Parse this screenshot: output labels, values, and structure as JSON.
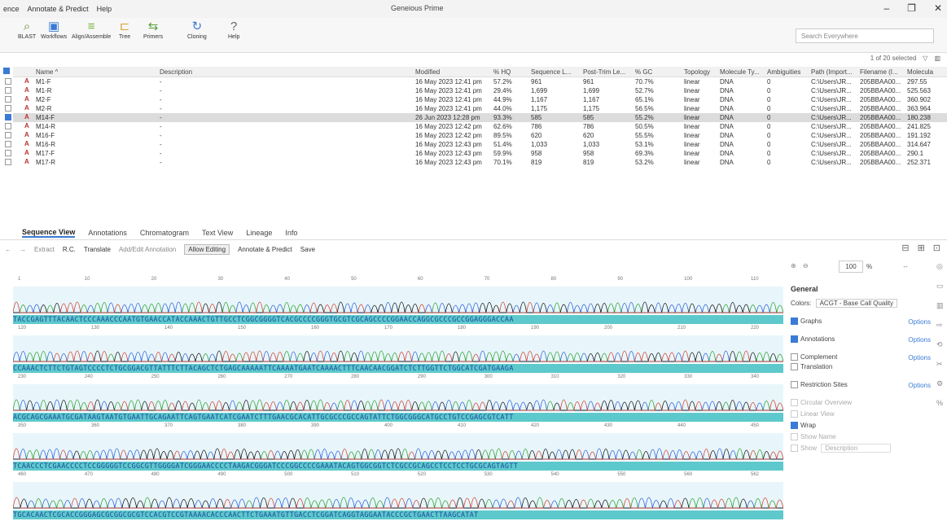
{
  "titlebar": {
    "menu": [
      "ence",
      "Annotate & Predict",
      "Help"
    ],
    "title": "Geneious Prime",
    "controls": [
      "–",
      "❐",
      "✕"
    ]
  },
  "toolbar": {
    "buttons": [
      {
        "label": "BLAST",
        "icon": "blast-icon"
      },
      {
        "label": "Workflows",
        "icon": "workflows-icon"
      },
      {
        "label": "Align/Assemble",
        "icon": "align-assemble-icon"
      },
      {
        "label": "Tree",
        "icon": "tree-icon"
      },
      {
        "label": "Primers",
        "icon": "primers-icon"
      },
      {
        "label": "Cloning",
        "icon": "cloning-icon"
      },
      {
        "label": "Help",
        "icon": "help-icon"
      }
    ],
    "search_placeholder": "Search Everywhere"
  },
  "table": {
    "selection_info": "1 of 20 selected",
    "columns": [
      "Name ^",
      "Description",
      "Modified",
      "% HQ",
      "Sequence L...",
      "Post-Trim Le...",
      "% GC",
      "Topology",
      "Molecule Ty...",
      "Ambiguities",
      "Path (Import...",
      "Filename (I...",
      "Molecula"
    ],
    "rows": [
      {
        "name": "M1-F",
        "desc": "-",
        "modified": "16 May 2023 12:41 pm",
        "hq": "57.2%",
        "seqlen": "961",
        "posttrim": "961",
        "gc": "70.7%",
        "topology": "linear",
        "moltype": "DNA",
        "amb": "0",
        "path": "C:\\Users\\JR...",
        "filename": "205BBAA00...",
        "mw": "297.55",
        "selected": false
      },
      {
        "name": "M1-R",
        "desc": "-",
        "modified": "16 May 2023 12:41 pm",
        "hq": "29.4%",
        "seqlen": "1,699",
        "posttrim": "1,699",
        "gc": "52.7%",
        "topology": "linear",
        "moltype": "DNA",
        "amb": "0",
        "path": "C:\\Users\\JR...",
        "filename": "205BBAA00...",
        "mw": "525.563",
        "selected": false
      },
      {
        "name": "M2-F",
        "desc": "-",
        "modified": "16 May 2023 12:41 pm",
        "hq": "44.9%",
        "seqlen": "1,167",
        "posttrim": "1,167",
        "gc": "65.1%",
        "topology": "linear",
        "moltype": "DNA",
        "amb": "0",
        "path": "C:\\Users\\JR...",
        "filename": "205BBAA00...",
        "mw": "360.902",
        "selected": false
      },
      {
        "name": "M2-R",
        "desc": "-",
        "modified": "16 May 2023 12:41 pm",
        "hq": "44.0%",
        "seqlen": "1,175",
        "posttrim": "1,175",
        "gc": "56.5%",
        "topology": "linear",
        "moltype": "DNA",
        "amb": "0",
        "path": "C:\\Users\\JR...",
        "filename": "205BBAA00...",
        "mw": "363.964",
        "selected": false
      },
      {
        "name": "M14-F",
        "desc": "-",
        "modified": "26 Jun 2023 12:28 pm",
        "hq": "93.3%",
        "seqlen": "585",
        "posttrim": "585",
        "gc": "55.2%",
        "topology": "linear",
        "moltype": "DNA",
        "amb": "0",
        "path": "C:\\Users\\JR...",
        "filename": "205BBAA00...",
        "mw": "180.238",
        "selected": true
      },
      {
        "name": "M14-R",
        "desc": "-",
        "modified": "16 May 2023 12:42 pm",
        "hq": "62.6%",
        "seqlen": "786",
        "posttrim": "786",
        "gc": "50.5%",
        "topology": "linear",
        "moltype": "DNA",
        "amb": "0",
        "path": "C:\\Users\\JR...",
        "filename": "205BBAA00...",
        "mw": "241.825",
        "selected": false
      },
      {
        "name": "M16-F",
        "desc": "-",
        "modified": "16 May 2023 12:42 pm",
        "hq": "89.5%",
        "seqlen": "620",
        "posttrim": "620",
        "gc": "55.5%",
        "topology": "linear",
        "moltype": "DNA",
        "amb": "0",
        "path": "C:\\Users\\JR...",
        "filename": "205BBAA00...",
        "mw": "191.192",
        "selected": false
      },
      {
        "name": "M16-R",
        "desc": "-",
        "modified": "16 May 2023 12:43 pm",
        "hq": "51.4%",
        "seqlen": "1,033",
        "posttrim": "1,033",
        "gc": "53.1%",
        "topology": "linear",
        "moltype": "DNA",
        "amb": "0",
        "path": "C:\\Users\\JR...",
        "filename": "205BBAA00...",
        "mw": "314.647",
        "selected": false
      },
      {
        "name": "M17-F",
        "desc": "-",
        "modified": "16 May 2023 12:43 pm",
        "hq": "59.9%",
        "seqlen": "958",
        "posttrim": "958",
        "gc": "69.3%",
        "topology": "linear",
        "moltype": "DNA",
        "amb": "0",
        "path": "C:\\Users\\JR...",
        "filename": "205BBAA00...",
        "mw": "290.1",
        "selected": false
      },
      {
        "name": "M17-R",
        "desc": "-",
        "modified": "16 May 2023 12:43 pm",
        "hq": "70.1%",
        "seqlen": "819",
        "posttrim": "819",
        "gc": "53.2%",
        "topology": "linear",
        "moltype": "DNA",
        "amb": "0",
        "path": "C:\\Users\\JR...",
        "filename": "205BBAA00...",
        "mw": "252.371",
        "selected": false
      }
    ]
  },
  "tabs": [
    "Sequence View",
    "Annotations",
    "Chromatogram",
    "Text View",
    "Lineage",
    "Info"
  ],
  "seqtoolbar": {
    "extract": "Extract",
    "rc": "R.C.",
    "translate": "Translate",
    "add_edit": "Add/Edit Annotation",
    "allow_editing": "Allow Editing",
    "annotate_predict": "Annotate & Predict",
    "save": "Save"
  },
  "sequence": {
    "rows": [
      {
        "ruler": [
          "1",
          "10",
          "20",
          "30",
          "40",
          "50",
          "60",
          "70",
          "80",
          "90",
          "100",
          "110"
        ],
        "seq": "TACCGAGTTTACAACTCCCAAACCCAATGTGAACCATACCAAACTGTTGCCTCGGCGGGGTCACGCCCCGGGTGCGTCGCAGCCCCGGAACCAGGCGCCCGCCGGAGGGACCAA"
      },
      {
        "ruler": [
          "120",
          "130",
          "140",
          "150",
          "160",
          "170",
          "180",
          "190",
          "200",
          "210",
          "220"
        ],
        "seq": "CCAAACTCTTCTGTAGTCCCCTCTGCGGACGTTATTTCTTACAGCTCTGAGCAAAAATTCAAAATGAATCAAAACTTTCAACAACGGATCTCTTGGTTCTGGCATCGATGAAGA"
      },
      {
        "ruler": [
          "230",
          "240",
          "250",
          "260",
          "270",
          "280",
          "290",
          "300",
          "310",
          "320",
          "330",
          "340"
        ],
        "seq": "ACGCAGCGAAATGCGATAAGTAATGTGAATTGCAGAATTCAGTGAATCATCGAATCTTTGAACGCACATTGCGCCCGCCAGTATTCTGGCGGGCATGCCTGTCCGAGCGTCATT"
      },
      {
        "ruler": [
          "350",
          "360",
          "370",
          "380",
          "390",
          "400",
          "410",
          "420",
          "430",
          "440",
          "450"
        ],
        "seq": "TCAACCCTCGAACCCCTCCGGGGGTCCGGCGTTGGGGATCGGGAACCCCTAAGACGGGATCCCGGCCCCGAAATACAGTGGCGGTCTCGCCGCAGCCTCCTCCTGCGCAGTAGTT"
      },
      {
        "ruler": [
          "460",
          "470",
          "480",
          "490",
          "500",
          "510",
          "520",
          "530",
          "540",
          "550",
          "560",
          "562"
        ],
        "seq": "TGCACAACTCGCACCGGGAGCGCGGCGCGTCCACGTCCGTAAAACACCCAACTTCTGAAATGTTGACCTCGGATCAGGTAGGAATACCCGCTGAACTTAAGCATAT"
      }
    ]
  },
  "panel": {
    "zoom": "100",
    "zoom_unit": "%",
    "general_title": "General",
    "colors_label": "Colors:",
    "colors_value": "ACGT - Base Call Quality",
    "graphs": "Graphs",
    "annotations": "Annotations",
    "complement": "Complement",
    "translation": "Translation",
    "restriction": "Restriction Sites",
    "circular": "Circular Overview",
    "linear": "Linear View",
    "wrap": "Wrap",
    "show_name": "Show Name",
    "show_label": "Show",
    "show_value": "Description",
    "options": "Options"
  }
}
